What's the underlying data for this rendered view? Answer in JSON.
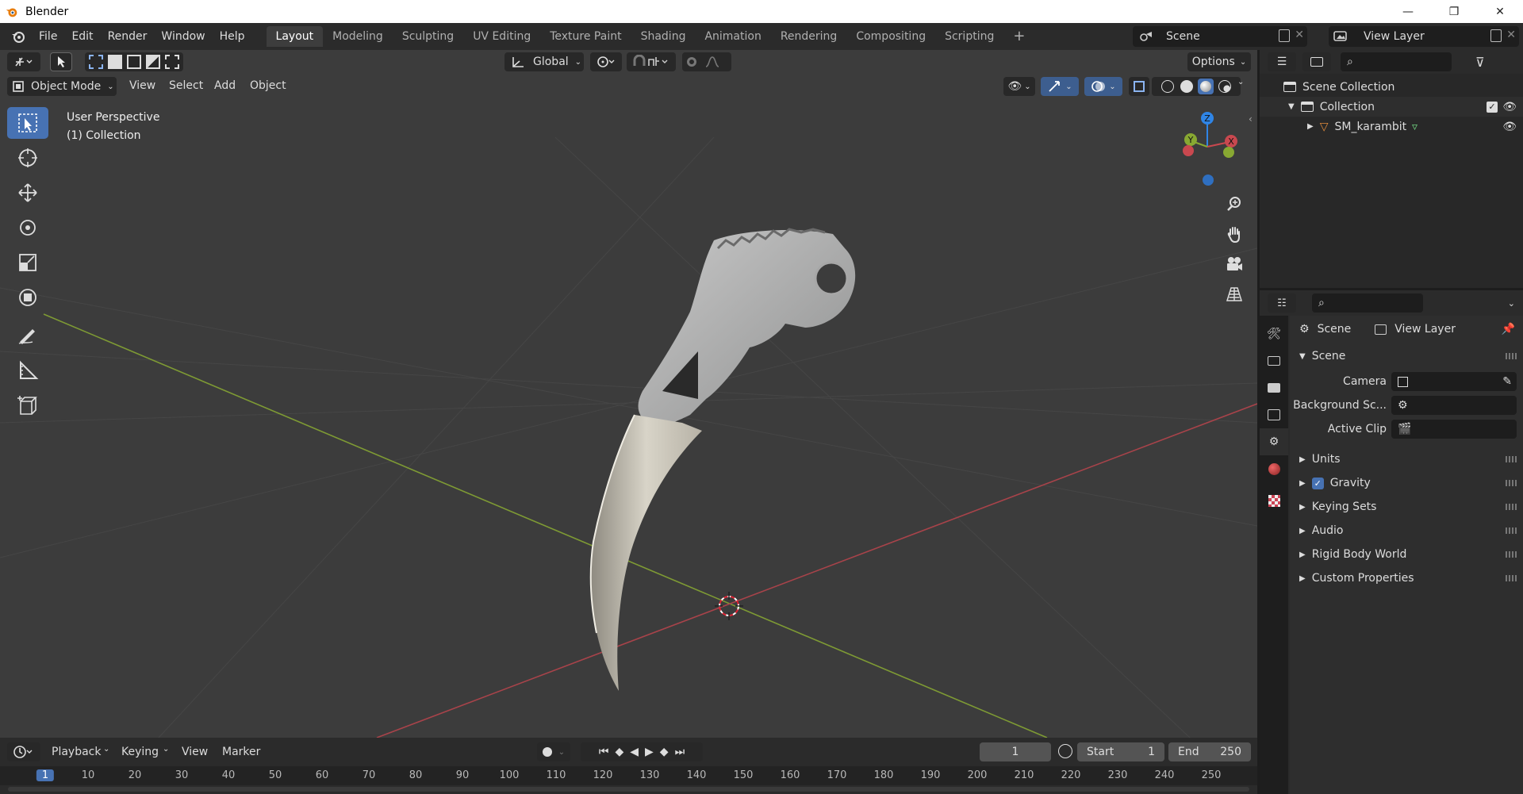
{
  "window": {
    "title": "Blender",
    "min": "—",
    "max": "❐",
    "close": "✕"
  },
  "menu": {
    "items": [
      "File",
      "Edit",
      "Render",
      "Window",
      "Help"
    ]
  },
  "workspaces": {
    "tabs": [
      "Layout",
      "Modeling",
      "Sculpting",
      "UV Editing",
      "Texture Paint",
      "Shading",
      "Animation",
      "Rendering",
      "Compositing",
      "Scripting"
    ],
    "active": "Layout",
    "add": "+"
  },
  "scene": {
    "name": "Scene",
    "view_layer": "View Layer"
  },
  "viewport": {
    "transform_orientation": "Global",
    "options": "Options",
    "mode": "Object Mode",
    "menus": [
      "View",
      "Select",
      "Add",
      "Object"
    ],
    "info_line1": "User Perspective",
    "info_line2": "(1) Collection",
    "gizmo": {
      "z": "Z",
      "y": "Y",
      "x": "X"
    }
  },
  "outliner": {
    "root": "Scene Collection",
    "collection": "Collection",
    "object": "SM_karambit"
  },
  "properties": {
    "crumb_scene": "Scene",
    "crumb_view_layer": "View Layer",
    "panel_scene": "Scene",
    "camera_label": "Camera",
    "background_label": "Background Sc...",
    "active_clip_label": "Active Clip",
    "panels": [
      "Units",
      "Gravity",
      "Keying Sets",
      "Audio",
      "Rigid Body World",
      "Custom Properties"
    ],
    "gravity_checked": true
  },
  "timeline": {
    "menus": [
      "Playback",
      "Keying",
      "View",
      "Marker"
    ],
    "current_frame": "1",
    "start_label": "Start",
    "start_value": "1",
    "end_label": "End",
    "end_value": "250",
    "ruler": [
      "1",
      "10",
      "20",
      "30",
      "40",
      "50",
      "60",
      "70",
      "80",
      "90",
      "100",
      "110",
      "120",
      "130",
      "140",
      "150",
      "160",
      "170",
      "180",
      "190",
      "200",
      "210",
      "220",
      "230",
      "240",
      "250"
    ]
  },
  "colors": {
    "accent": "#4772b3",
    "x_axis": "#c9484f",
    "y_axis": "#88a832",
    "z_axis": "#2f85e6"
  }
}
